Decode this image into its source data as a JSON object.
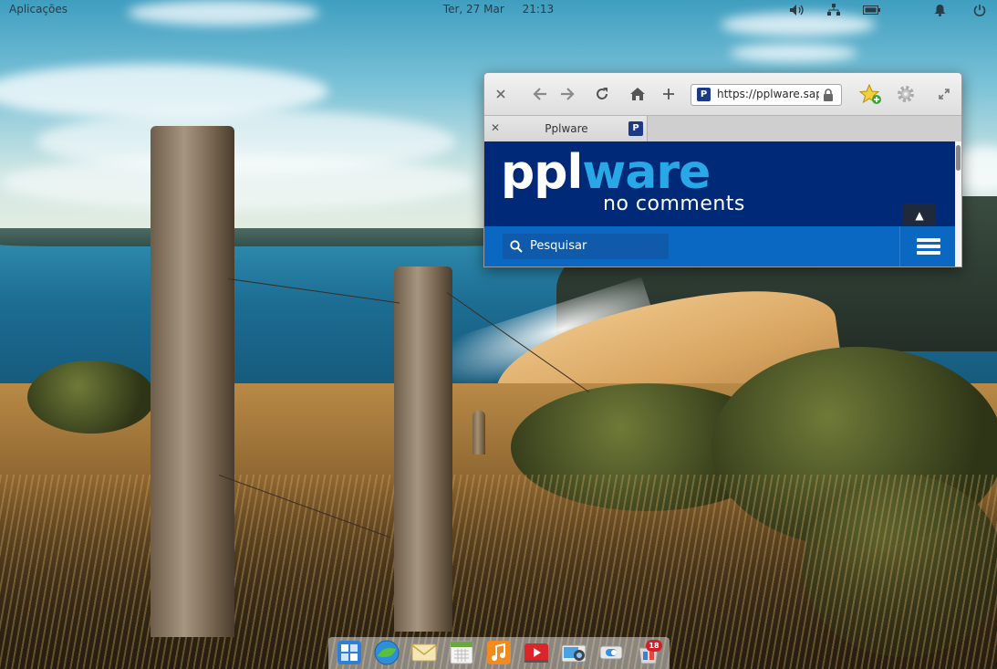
{
  "panel": {
    "applications_label": "Aplicações",
    "date": "Ter, 27 Mar",
    "time": "21:13",
    "tray_icons": [
      "volume-icon",
      "network-icon",
      "battery-icon",
      "notifications-icon",
      "power-icon"
    ]
  },
  "browser": {
    "url": "https://pplware.sapo",
    "tab": {
      "title": "Pplware",
      "favicon_letter": "P"
    },
    "page": {
      "logo_part1": "ppl",
      "logo_part2": "ware",
      "tagline": "no comments",
      "search_placeholder": "Pesquisar",
      "scroll_top_glyph": "▲"
    },
    "colors": {
      "site_bg": "#002a78",
      "site_nav": "#0a68c2",
      "logo_accent": "#29a8e8"
    }
  },
  "dock": {
    "apps": [
      "multitasking-view-icon",
      "web-browser-icon",
      "mail-icon",
      "calendar-icon",
      "music-icon",
      "videos-icon",
      "photos-icon",
      "system-settings-icon",
      "appcenter-icon"
    ],
    "appcenter_badge": "18"
  }
}
